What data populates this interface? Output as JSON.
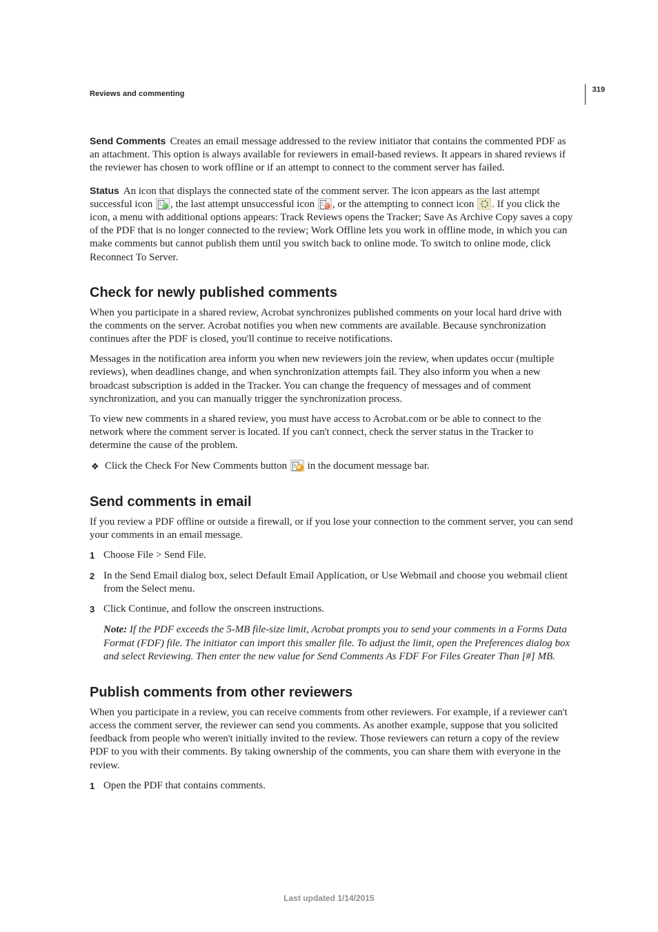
{
  "page_number": "319",
  "chapter": "Reviews and commenting",
  "definitions": {
    "send_comments": {
      "term": "Send Comments",
      "text": "Creates an email message addressed to the review initiator that contains the commented PDF as an attachment. This option is always available for reviewers in email-based reviews. It appears in shared reviews if the reviewer has chosen to work offline or if an attempt to connect to the comment server has failed."
    },
    "status": {
      "term": "Status",
      "parts": {
        "p1": "An icon that displays the connected state of the comment server. The icon appears as the last attempt successful icon ",
        "p2": ", the last attempt unsuccessful icon ",
        "p3": ", or the attempting to connect icon ",
        "p4": ". If you click the icon, a menu with additional options appears: Track Reviews opens the Tracker; Save As Archive Copy saves a copy of the PDF that is no longer connected to the review; Work Offline lets you work in offline mode, in which you can make comments but cannot publish them until you switch back to online mode. To switch to online mode, click Reconnect To Server."
      }
    }
  },
  "section_check": {
    "heading": "Check for newly published comments",
    "p1": "When you participate in a shared review, Acrobat synchronizes published comments on your local hard drive with the comments on the server. Acrobat notifies you when new comments are available. Because synchronization continues after the PDF is closed, you'll continue to receive notifications.",
    "p2": "Messages in the notification area inform you when new reviewers join the review, when updates occur (multiple reviews), when deadlines change, and when synchronization attempts fail. They also inform you when a new broadcast subscription is added in the Tracker. You can change the frequency of messages and of comment synchronization, and you can manually trigger the synchronization process.",
    "p3": "To view new comments in a shared review, you must have access to Acrobat.com or be able to connect to the network where the comment server is located. If you can't connect, check the server status in the Tracker to determine the cause of the problem.",
    "bullet": {
      "before": "Click the Check For New Comments button ",
      "after": " in the document message bar."
    }
  },
  "section_send": {
    "heading": "Send comments in email",
    "intro": "If you review a PDF offline or outside a firewall, or if you lose your connection to the comment server, you can send your comments in an email message.",
    "steps": {
      "n1": "1",
      "s1": "Choose File > Send File.",
      "n2": "2",
      "s2": "In the Send Email dialog box, select Default Email Application, or Use Webmail and choose you webmail client from the Select menu.",
      "n3": "3",
      "s3": "Click Continue, and follow the onscreen instructions."
    },
    "note": {
      "label": "Note: ",
      "text": "If the PDF exceeds the 5-MB file-size limit, Acrobat prompts you to send your comments in a Forms Data Format (FDF) file. The initiator can import this smaller file. To adjust the limit, open the Preferences dialog box and select Reviewing. Then enter the new value for Send Comments As FDF For Files Greater Than [#] MB."
    }
  },
  "section_publish": {
    "heading": "Publish comments from other reviewers",
    "p1": "When you participate in a review, you can receive comments from other reviewers. For example, if a reviewer can't access the comment server, the reviewer can send you comments. As another example, suppose that you solicited feedback from people who weren't initially invited to the review. Those reviewers can return a copy of the review PDF to you with their comments. By taking ownership of the comments, you can share them with everyone in the review.",
    "steps": {
      "n1": "1",
      "s1": "Open the PDF that contains comments."
    }
  },
  "footer": "Last updated 1/14/2015"
}
